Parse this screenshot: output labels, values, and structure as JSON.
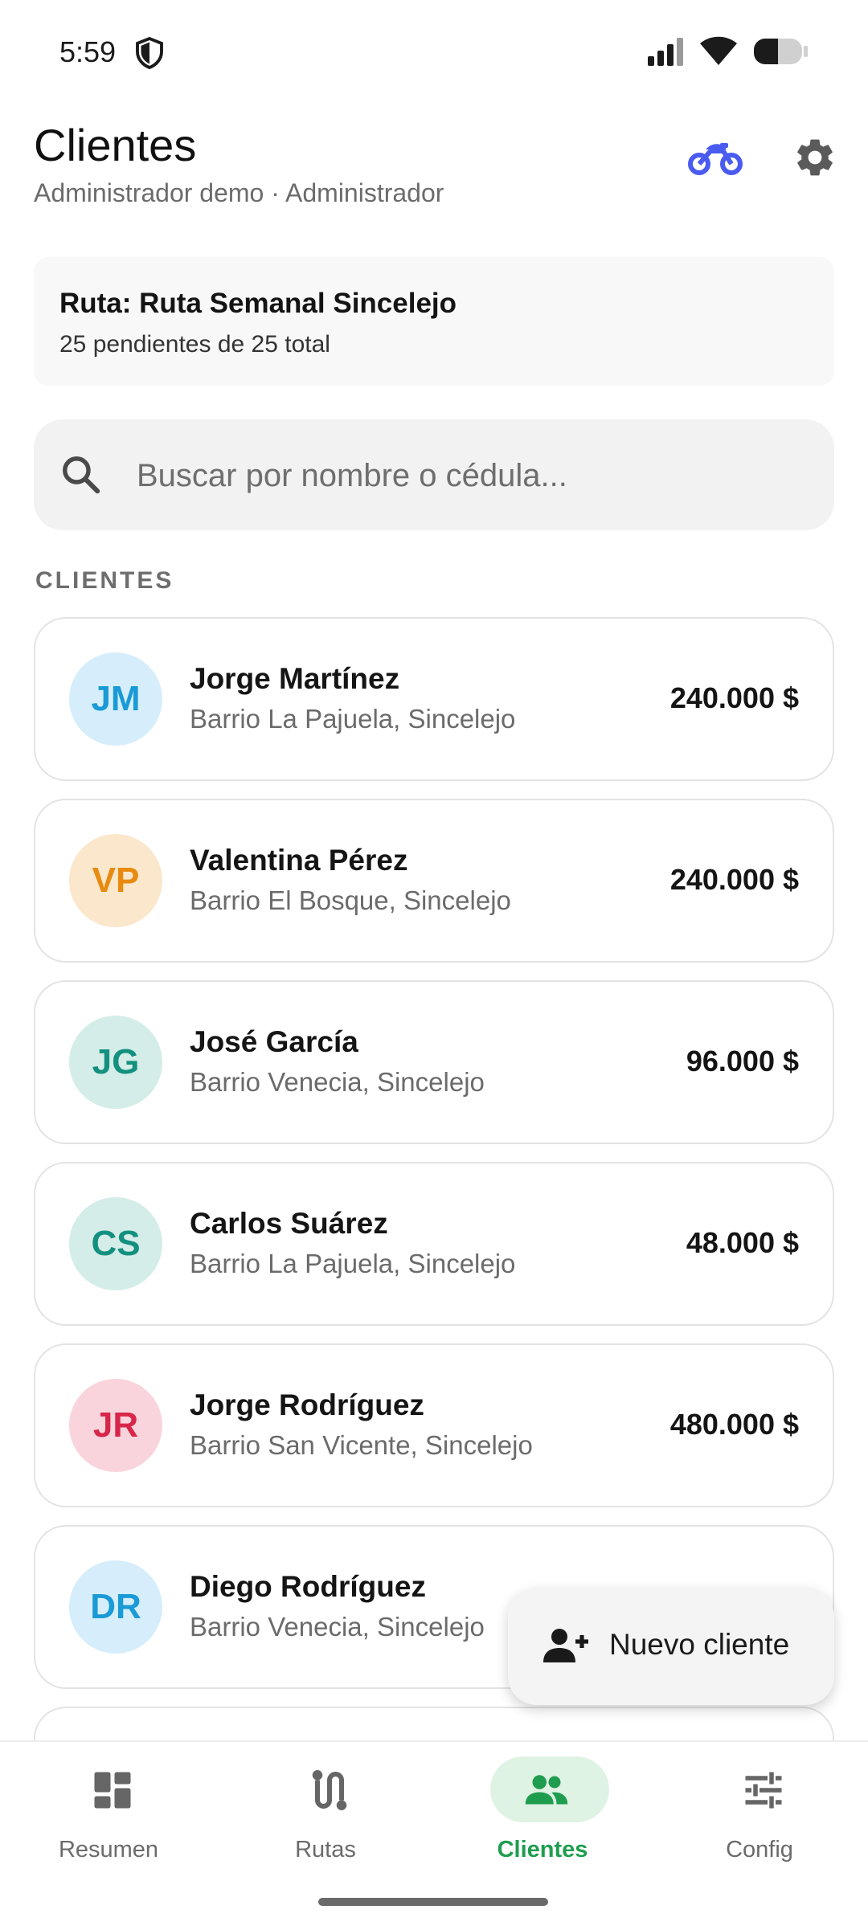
{
  "status_bar": {
    "time": "5:59"
  },
  "header": {
    "title": "Clientes",
    "subtitle": "Administrador demo · Administrador"
  },
  "route": {
    "title": "Ruta: Ruta Semanal Sincelejo",
    "summary": "25 pendientes de 25 total"
  },
  "search": {
    "placeholder": "Buscar por nombre o cédula..."
  },
  "section_label": "CLIENTES",
  "clients": [
    {
      "initials": "JM",
      "name": "Jorge Martínez",
      "address": "Barrio La Pajuela, Sincelejo",
      "amount": "240.000 $",
      "avatar_bg": "#d6eefb",
      "avatar_fg": "#1a9ad6"
    },
    {
      "initials": "VP",
      "name": "Valentina Pérez",
      "address": "Barrio El Bosque, Sincelejo",
      "amount": "240.000 $",
      "avatar_bg": "#fbe7cc",
      "avatar_fg": "#e88a10"
    },
    {
      "initials": "JG",
      "name": "José García",
      "address": "Barrio Venecia, Sincelejo",
      "amount": "96.000 $",
      "avatar_bg": "#d4ede8",
      "avatar_fg": "#13907f"
    },
    {
      "initials": "CS",
      "name": "Carlos Suárez",
      "address": "Barrio La Pajuela, Sincelejo",
      "amount": "48.000 $",
      "avatar_bg": "#d4ede8",
      "avatar_fg": "#13907f"
    },
    {
      "initials": "JR",
      "name": "Jorge Rodríguez",
      "address": "Barrio San Vicente, Sincelejo",
      "amount": "480.000 $",
      "avatar_bg": "#fad4dc",
      "avatar_fg": "#d8264a"
    },
    {
      "initials": "DR",
      "name": "Diego Rodríguez",
      "address": "Barrio Venecia, Sincelejo",
      "amount": "",
      "avatar_bg": "#d6eefb",
      "avatar_fg": "#1a9ad6"
    }
  ],
  "fab": {
    "label": "Nuevo cliente"
  },
  "bottom_nav": [
    {
      "label": "Resumen",
      "icon": "dashboard-icon",
      "active": false
    },
    {
      "label": "Rutas",
      "icon": "route-icon",
      "active": false
    },
    {
      "label": "Clientes",
      "icon": "people-icon",
      "active": true
    },
    {
      "label": "Config",
      "icon": "tune-icon",
      "active": false
    }
  ],
  "colors": {
    "accent_green": "#1f9d4f",
    "moto_icon": "#4a5cf0"
  }
}
